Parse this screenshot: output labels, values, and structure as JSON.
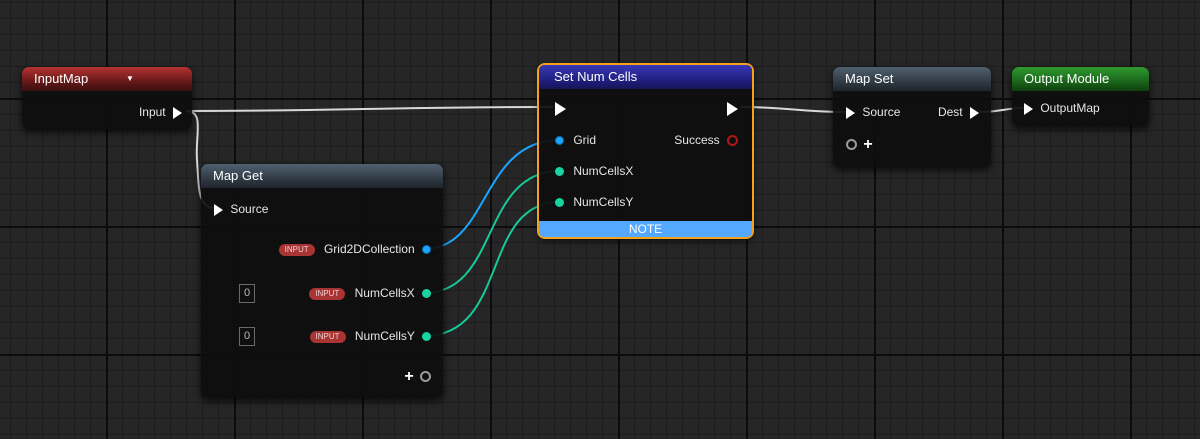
{
  "nodes": {
    "input_map": {
      "title": "InputMap",
      "output_label": "Input"
    },
    "map_get": {
      "title": "Map Get",
      "source_label": "Source",
      "outputs": [
        {
          "tag": "INPUT",
          "label": "Grid2DCollection"
        },
        {
          "tag": "INPUT",
          "label": "NumCellsX",
          "value": "0"
        },
        {
          "tag": "INPUT",
          "label": "NumCellsY",
          "value": "0"
        }
      ],
      "add_pin": "+"
    },
    "set_num_cells": {
      "title": "Set Num Cells",
      "inputs": [
        "Grid",
        "NumCellsX",
        "NumCellsY"
      ],
      "success_label": "Success",
      "note_label": "NOTE"
    },
    "map_set": {
      "title": "Map Set",
      "source_label": "Source",
      "dest_label": "Dest",
      "add_pin": "+"
    },
    "output_module": {
      "title": "Output Module",
      "input_label": "OutputMap"
    }
  },
  "colors": {
    "exec_wire": "#d8d8d8",
    "grid_wire": "#1ca6ff",
    "int_wire": "#18c99a",
    "selection": "#f2a21c",
    "note": "#55a8ff"
  }
}
